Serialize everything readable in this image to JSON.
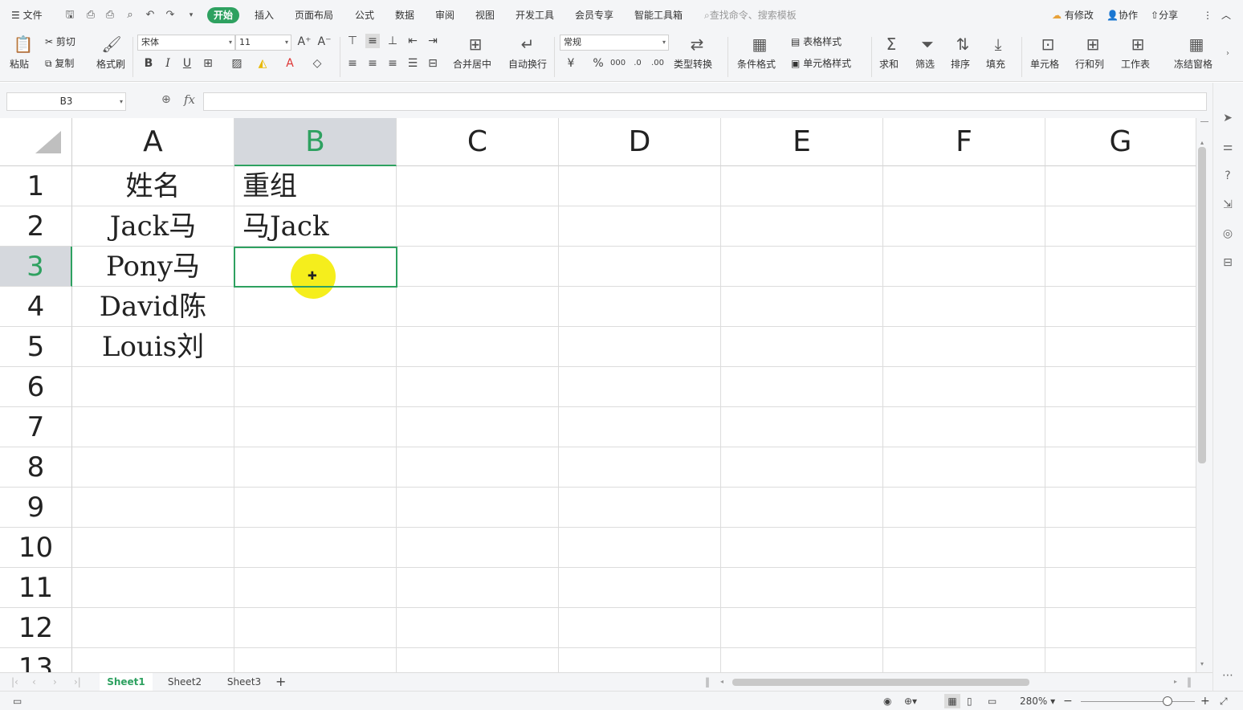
{
  "menubar": {
    "file": "文件",
    "tabs": [
      "开始",
      "插入",
      "页面布局",
      "公式",
      "数据",
      "审阅",
      "视图",
      "开发工具",
      "会员专享",
      "智能工具箱"
    ],
    "search_placeholder": "查找命令、搜索模板",
    "has_changes": "有修改",
    "collaborate": "协作",
    "share": "分享"
  },
  "ribbon": {
    "paste": "粘贴",
    "cut": "剪切",
    "copy": "复制",
    "format_painter": "格式刷",
    "font_name": "宋体",
    "font_size": "11",
    "bold": "B",
    "italic": "I",
    "underline": "U",
    "merge_center": "合并居中",
    "wrap_text": "自动换行",
    "number_format": "常规",
    "type_convert": "类型转换",
    "conditional_format": "条件格式",
    "table_style": "表格样式",
    "cell_style": "单元格样式",
    "sum": "求和",
    "filter": "筛选",
    "sort": "排序",
    "fill": "填充",
    "cell": "单元格",
    "row_col": "行和列",
    "worksheet": "工作表",
    "freeze": "冻结窗格"
  },
  "formula_bar": {
    "name_box": "B3",
    "fx": "fx",
    "value": ""
  },
  "sheet": {
    "columns": [
      "A",
      "B",
      "C",
      "D",
      "E",
      "F",
      "G"
    ],
    "selected_column": "B",
    "rows": [
      "1",
      "2",
      "3",
      "4",
      "5",
      "6",
      "7",
      "8",
      "9",
      "10",
      "11",
      "12",
      "13"
    ],
    "selected_row": "3",
    "colA": [
      "姓名",
      "Jack马",
      "Pony马",
      "David陈",
      "Louis刘"
    ],
    "colB": [
      "重组",
      "马Jack"
    ]
  },
  "tabs": [
    "Sheet1",
    "Sheet2",
    "Sheet3"
  ],
  "active_tab": "Sheet1",
  "status": {
    "zoom": "280%"
  },
  "colors": {
    "accent": "#2ea160",
    "cursor_highlight": "#f5ee1c"
  }
}
